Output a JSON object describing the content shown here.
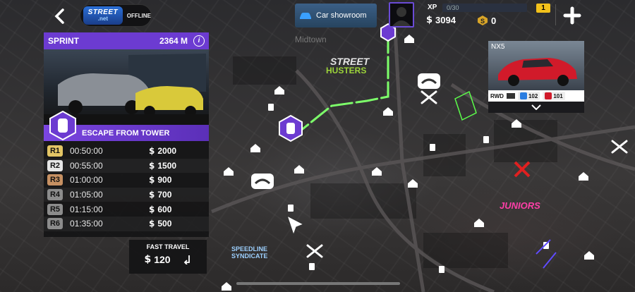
{
  "topbar": {
    "logo_top": "STREET",
    "logo_bottom": ".net",
    "status": "OFFLINE",
    "showroom_label": "Car showroom",
    "xp_label": "XP",
    "xp_progress": "0/30",
    "level": "1",
    "cash": "3094",
    "gold": "0"
  },
  "race": {
    "mode": "SPRINT",
    "distance": "2364 M",
    "info_icon": "i",
    "name": "ESCAPE FROM TOWER",
    "rewards": [
      {
        "rank": "R1",
        "time": "00:50:00",
        "prize": "2000",
        "tier": "gold"
      },
      {
        "rank": "R2",
        "time": "00:55:00",
        "prize": "1500",
        "tier": "silver"
      },
      {
        "rank": "R3",
        "time": "01:00:00",
        "prize": "900",
        "tier": "bronze"
      },
      {
        "rank": "R4",
        "time": "01:05:00",
        "prize": "700",
        "tier": "grey"
      },
      {
        "rank": "R5",
        "time": "01:15:00",
        "prize": "600",
        "tier": "grey"
      },
      {
        "rank": "R6",
        "time": "01:35:00",
        "prize": "500",
        "tier": "grey"
      }
    ]
  },
  "fast_travel": {
    "label": "FAST TRAVEL",
    "cost": "120"
  },
  "car_card": {
    "name": "NX5",
    "drive": "RWD",
    "stat1": "102",
    "stat2": "101"
  },
  "map": {
    "district": "Midtown",
    "crews": [
      "STREET HUSTERS",
      "JUNIORS",
      "SPEEDLINE SYNDICATE"
    ],
    "accent_route": "#7dff6a"
  },
  "icons": {
    "back": "chevron-left-icon",
    "plus": "plus-icon",
    "currency": "dollar-icon",
    "gold": "gold-coin-icon"
  }
}
